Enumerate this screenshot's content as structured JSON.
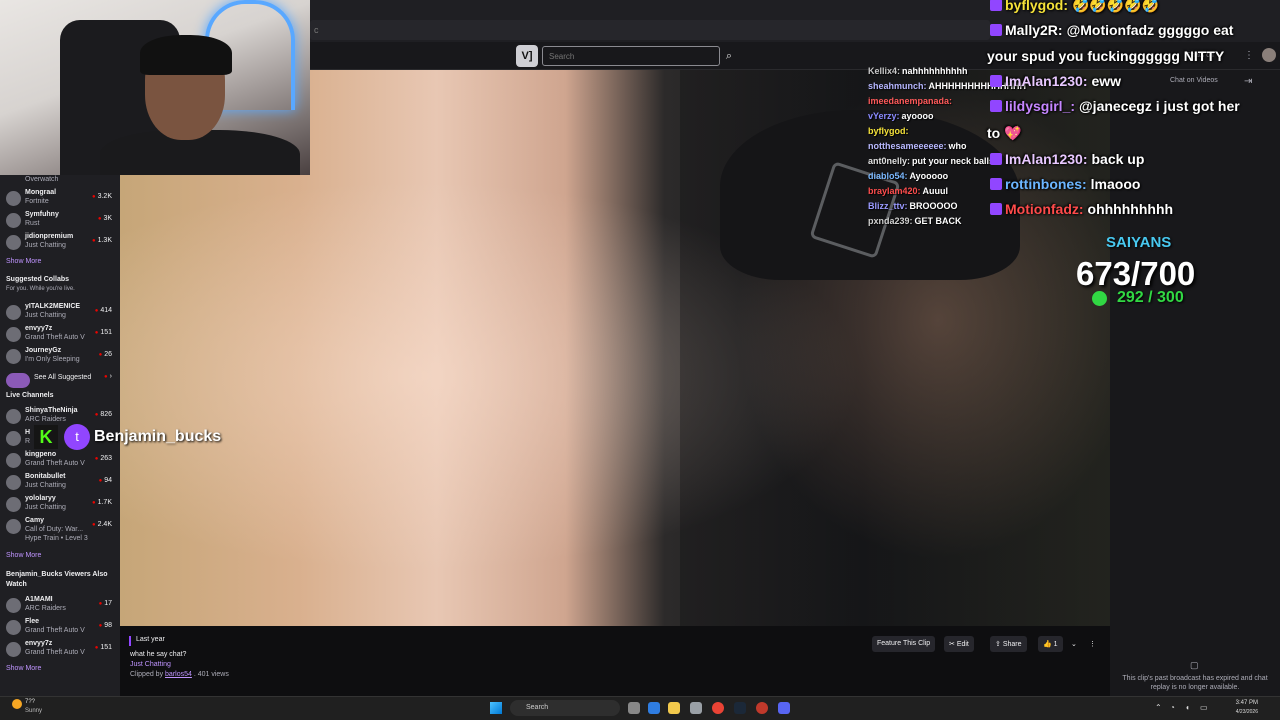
{
  "browser": {
    "address_hint": "c"
  },
  "header": {
    "logo": "V]",
    "search_placeholder": "Search"
  },
  "sidebar": {
    "top_items": [
      {
        "name": "",
        "game": "Overwatch",
        "viewers": ""
      },
      {
        "name": "Mongraal",
        "game": "Fortnite",
        "viewers": "3.2K"
      },
      {
        "name": "Symfuhny",
        "game": "Rust",
        "viewers": "3K"
      },
      {
        "name": "jidionpremium",
        "game": "Just Chatting",
        "viewers": "1.3K"
      }
    ],
    "show_more_1": "Show More",
    "suggested_title": "Suggested Collabs",
    "suggested_sub": "For you. While you're live.",
    "suggested": [
      {
        "name": "yITALK2MENICE",
        "game": "Just Chatting",
        "viewers": "414"
      },
      {
        "name": "envyy7z",
        "game": "Grand Theft Auto V",
        "viewers": "151"
      },
      {
        "name": "JourneyGz",
        "game": "I'm Only Sleeping",
        "viewers": "26"
      }
    ],
    "see_all": "See All Suggested",
    "live_title": "Live Channels",
    "live": [
      {
        "name": "ShinyaTheNinja",
        "game": "ARC Raiders",
        "viewers": "826"
      },
      {
        "name": "H",
        "game": "R",
        "viewers": ""
      },
      {
        "name": "kingpeno",
        "game": "Grand Theft Auto V",
        "viewers": "263"
      },
      {
        "name": "Bonitabullet",
        "game": "Just Chatting",
        "viewers": "94"
      },
      {
        "name": "yololaryy",
        "game": "Just Chatting",
        "viewers": "1.7K"
      },
      {
        "name": "Camy",
        "game": "Call of Duty: War...",
        "viewers": "2.4K"
      }
    ],
    "hype_train": "Hype Train • Level 3",
    "show_more_2": "Show More",
    "also_watch_title": "Benjamin_Bucks Viewers Also Watch",
    "also_watch": [
      {
        "name": "A1MAMI",
        "game": "ARC Raiders",
        "viewers": "17"
      },
      {
        "name": "Flee",
        "game": "Grand Theft Auto V",
        "viewers": "98"
      },
      {
        "name": "envyy7z",
        "game": "Grand Theft Auto V",
        "viewers": "151"
      }
    ],
    "show_more_3": "Show More"
  },
  "overlay_user": {
    "kick": "K",
    "twitch": "t",
    "name": "Benjamin_bucks"
  },
  "video_chat": [
    {
      "user": "Kellix4:",
      "msg": "nahhhhhhhhhh",
      "color": "#c8c8c8"
    },
    {
      "user": "sheahmunch:",
      "msg": "AHHHHHHHHHHHHHH",
      "color": "#b6b6ff"
    },
    {
      "user": "imeedanempanada:",
      "msg": "",
      "color": "#ff5a5a"
    },
    {
      "user": "vYerzy:",
      "msg": "ayoooo",
      "color": "#8a8aff"
    },
    {
      "user": "byflygod:",
      "msg": "",
      "color": "#f5e23a"
    },
    {
      "user": "notthesameeeeee:",
      "msg": "who",
      "color": "#b9b9ff"
    },
    {
      "user": "ant0nelly:",
      "msg": "put your neck balls",
      "color": "#e0e0e0"
    },
    {
      "user": "diablo54:",
      "msg": "Ayooooo",
      "color": "#7ab8ff"
    },
    {
      "user": "braylam420:",
      "msg": "Auuul",
      "color": "#ff4d4d"
    },
    {
      "user": "Blizz_ttv:",
      "msg": "BROOOOO",
      "color": "#9a9aff"
    },
    {
      "user": "pxnda239:",
      "msg": "GET BACK",
      "color": "#d0d0d0"
    }
  ],
  "big_chat": [
    {
      "user": "byflygod:",
      "msg": "🤣🤣🤣🤣🤣",
      "color": "#f5e23a"
    },
    {
      "user": "Mally2R:",
      "msg": "@Motionfadz gggggo eat",
      "color": "#ffffff"
    },
    {
      "user": "",
      "msg": "your spud you fuckingggggg NITTY",
      "color": "#ffffff"
    },
    {
      "user": "ImAlan1230:",
      "msg": "eww",
      "color": "#e8c8ff"
    },
    {
      "user": "lildysgirl_:",
      "msg": "@janecegz i just got her",
      "color": "#c586ff"
    },
    {
      "user": "",
      "msg": "to 💖",
      "color": "#ffffff"
    },
    {
      "user": "ImAlan1230:",
      "msg": "back up",
      "color": "#e8c8ff"
    },
    {
      "user": "rottinbones:",
      "msg": "lmaooo",
      "color": "#6cb6ff"
    },
    {
      "user": "Motionfadz:",
      "msg": "ohhhhhhhhh",
      "color": "#ff4b4b"
    }
  ],
  "goal": {
    "team": "SAIYANS",
    "count": "673/700",
    "sub": "292 / 300"
  },
  "right_panel": {
    "toggle": "Chats off",
    "label": "Chat on Videos",
    "expired": "This clip's past broadcast has expired and chat replay is no longer available."
  },
  "clip_info": {
    "when": "Last year",
    "title": "what he say chat?",
    "category": "Just Chatting",
    "clipped_prefix": "Clipped by",
    "clipper": "barlos54",
    "views": ". 401 views",
    "feature_btn": "Feature This Clip",
    "edit_btn": "Edit",
    "share_btn": "Share",
    "like_count": "1"
  },
  "taskbar": {
    "temp": "7??",
    "condition": "Sunny",
    "search": "Search",
    "time": "3:47 PM",
    "date": "4/23/2026"
  }
}
